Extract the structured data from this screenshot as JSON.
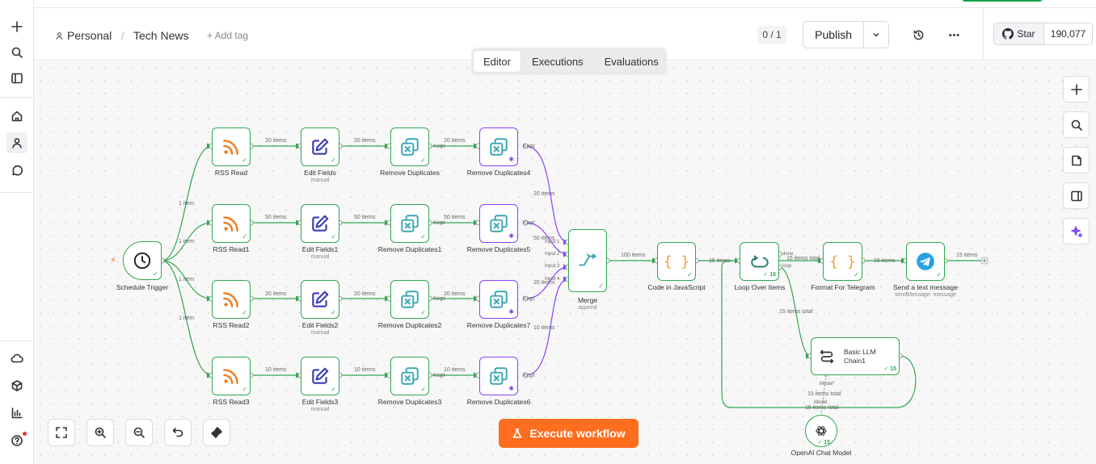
{
  "breadcrumb": {
    "project": "Personal",
    "separator": "/",
    "workflow": "Tech News",
    "add_tag": "+ Add tag"
  },
  "header": {
    "version": "0 / 1",
    "publish": "Publish",
    "github_star": "Star",
    "github_count": "190,077"
  },
  "tabs": [
    {
      "label": "Editor",
      "active": true
    },
    {
      "label": "Executions"
    },
    {
      "label": "Evaluations"
    }
  ],
  "execute_button": "Execute workflow",
  "colors": {
    "success": "#2fa84f",
    "pinned": "#8a3ffc",
    "accent": "#ff6d1f",
    "rss": "#f07a1c",
    "edit": "#3b3bb8",
    "dedupe": "#3aa6b5",
    "code": "#f29d38",
    "telegram": "#27a3e2"
  },
  "nodes": {
    "schedule": {
      "label": "Schedule Trigger"
    },
    "rss0": {
      "label": "RSS Read"
    },
    "rss1": {
      "label": "RSS Read1"
    },
    "rss2": {
      "label": "RSS Read2"
    },
    "rss3": {
      "label": "RSS Read3"
    },
    "edit0": {
      "label": "Edit Fields",
      "sub": "manual"
    },
    "edit1": {
      "label": "Edit Fields1",
      "sub": "manual"
    },
    "edit2": {
      "label": "Edit Fields2",
      "sub": "manual"
    },
    "edit3": {
      "label": "Edit Fields3",
      "sub": "manual"
    },
    "dup0": {
      "label": "Remove Duplicates"
    },
    "dup1": {
      "label": "Remove Duplicates1"
    },
    "dup2": {
      "label": "Remove Duplicates2"
    },
    "dup3": {
      "label": "Remove Duplicates3"
    },
    "dupp0": {
      "label": "Remove Duplicates4"
    },
    "dupp1": {
      "label": "Remove Duplicates5"
    },
    "dupp2": {
      "label": "Remove Duplicates7"
    },
    "dupp3": {
      "label": "Remove Duplicates6"
    },
    "merge": {
      "label": "Merge",
      "sub": "append",
      "inputs": [
        "Input 1",
        "Input 2",
        "Input 3",
        "Input 4"
      ]
    },
    "code": {
      "label": "Code in JavaScript"
    },
    "loop": {
      "label": "Loop Over Items",
      "badge": "16",
      "out_done": "done",
      "out_loop": "loop"
    },
    "format": {
      "label": "Format For Telegram"
    },
    "telegram": {
      "label": "Send a text message",
      "sub": "sendMessage: message"
    },
    "llm": {
      "label_1": "Basic LLM",
      "label_2": "Chain1",
      "badge": "15",
      "model_port": "Model*"
    },
    "openai": {
      "label": "OpenAI Chat Model",
      "badge": "15",
      "port": "Model"
    }
  },
  "edges": {
    "sched_rss": [
      "1 item",
      "1 item",
      "1 item",
      "1 item"
    ],
    "rss_edit": [
      "20 items",
      "50 items",
      "20 items",
      "10 items"
    ],
    "edit_dup": [
      "20 items",
      "50 items",
      "20 items",
      "10 items"
    ],
    "dup_dupp": [
      "20 items",
      "50 items",
      "20 items",
      "10 items"
    ],
    "kept": "Kept",
    "to_merge": [
      "20 items",
      "50 items",
      "20 items",
      "10 items"
    ],
    "merge_code": "100 items",
    "code_loop": "15 items",
    "loop_format": "15 items total",
    "format_telegram": "15 items",
    "telegram_out": "15 items",
    "loop_llm": "15 items total",
    "llm_model": "15 items total",
    "llm_back": "15 items total"
  }
}
